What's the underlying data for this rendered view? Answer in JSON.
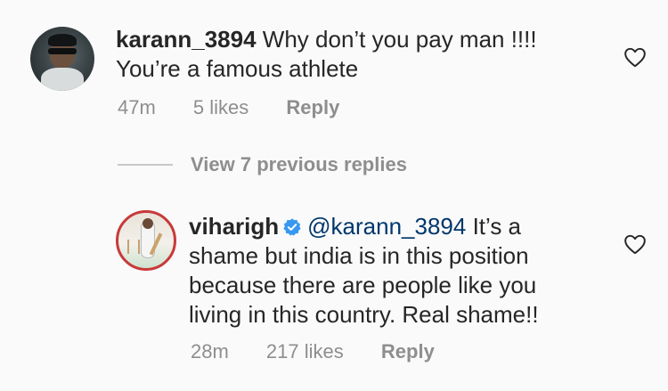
{
  "comments": [
    {
      "username": "karann_3894",
      "text_line1": "Why don’t you pay man !!!!",
      "text_line2": "You’re a famous athlete",
      "time": "47m",
      "likes": "5 likes",
      "reply": "Reply"
    },
    {
      "username": "viharigh",
      "verified": true,
      "mention": "@karann_3894",
      "text_line1_rest": " It’s a",
      "text_line2": "shame but india is in this position",
      "text_line3": "because there are people like you",
      "text_line4": "living in this country. Real shame!!",
      "time": "28m",
      "likes": "217 likes",
      "reply": "Reply"
    }
  ],
  "view_replies": {
    "label": "View 7 previous replies"
  },
  "icons": {
    "like": "heart-outline-icon",
    "verified": "verified-badge-icon"
  },
  "colors": {
    "text": "#262626",
    "meta": "#8e8e8e",
    "mention": "#00376b",
    "verified": "#3897f0"
  }
}
